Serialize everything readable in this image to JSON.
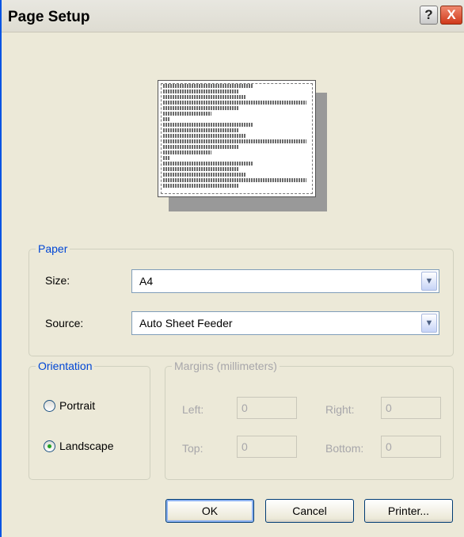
{
  "window": {
    "title": "Page Setup",
    "help_icon_glyph": "?",
    "close_icon_glyph": "X"
  },
  "paper": {
    "legend": "Paper",
    "size_label": "Size:",
    "size_value": "A4",
    "source_label": "Source:",
    "source_value": "Auto Sheet Feeder"
  },
  "orientation": {
    "legend": "Orientation",
    "portrait_label": "Portrait",
    "landscape_label": "Landscape",
    "selected": "landscape"
  },
  "margins": {
    "legend": "Margins (millimeters)",
    "left_label": "Left:",
    "left_value": "0",
    "right_label": "Right:",
    "right_value": "0",
    "top_label": "Top:",
    "top_value": "0",
    "bottom_label": "Bottom:",
    "bottom_value": "0"
  },
  "buttons": {
    "ok": "OK",
    "cancel": "Cancel",
    "printer": "Printer..."
  },
  "colors": {
    "accent": "#0046d5",
    "disabled_text": "#a7a6aa",
    "dialog_bg": "#ece9d8",
    "radio_dot": "#21a121"
  }
}
